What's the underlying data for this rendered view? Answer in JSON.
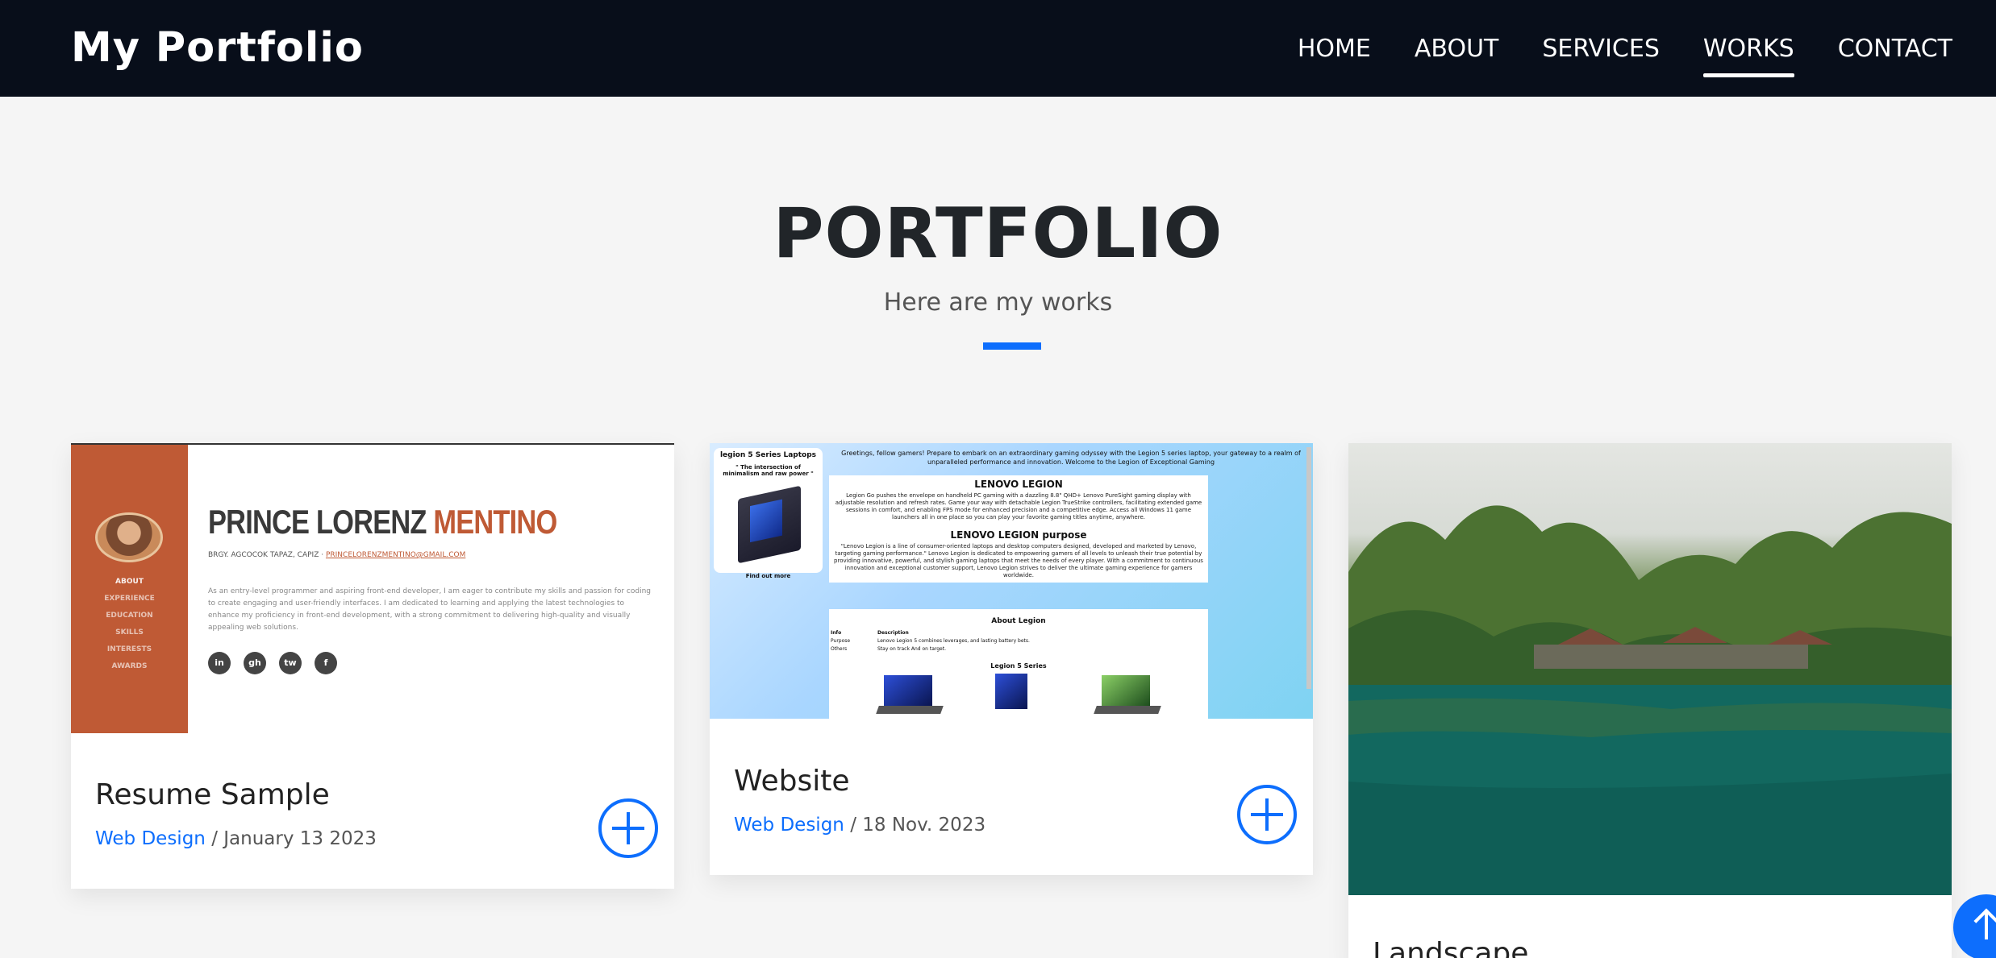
{
  "navbar": {
    "brand": "My Portfolio",
    "links": [
      "HOME",
      "ABOUT",
      "SERVICES",
      "WORKS",
      "CONTACT"
    ],
    "active": "WORKS"
  },
  "section": {
    "title": "PORTFOLIO",
    "subtitle": "Here are my works"
  },
  "works": [
    {
      "title": "Resume Sample",
      "category": "Web Design",
      "separator": "/",
      "date": "January 13 2023",
      "thumbnail": {
        "name_first": "PRINCE LORENZ ",
        "name_last": "MENTINO",
        "contact": "BRGY. AGCOCOK TAPAZ, CAPIZ",
        "email": "PRINCELORENZMENTINO@GMAIL.COM",
        "menu": [
          "ABOUT",
          "EXPERIENCE",
          "EDUCATION",
          "SKILLS",
          "INTERESTS",
          "AWARDS"
        ],
        "description": "As an entry-level programmer and aspiring front-end developer, I am eager to contribute my skills and passion for coding to create engaging and user-friendly interfaces. I am dedicated to learning and applying the latest technologies to enhance my proficiency in front-end development, with a strong commitment to delivering high-quality and visually appealing web solutions.",
        "socials": [
          "in",
          "gh",
          "tw",
          "f"
        ]
      }
    },
    {
      "title": "Website",
      "category": "Web Design",
      "separator": "/",
      "date": "18 Nov. 2023",
      "thumbnail": {
        "sidebar_title": "legion 5 Series Laptops",
        "sidebar_quote": "\" The intersection of minimalism and raw power \"",
        "sidebar_link": "Find out more",
        "intro": "Greetings, fellow gamers! Prepare to embark on an extraordinary gaming odyssey with the Legion 5 series laptop, your gateway to a realm of unparalleled performance and innovation. Welcome to the Legion of Exceptional Gaming",
        "box1_title": "LENOVO LEGION",
        "box1_text": "Legion Go pushes the envelope on handheld PC gaming with a dazzling 8.8\" QHD+ Lenovo PureSight gaming display with adjustable resolution and refresh rates. Game your way with detachable Legion TrueStrike controllers, facilitating extended game sessions in comfort, and enabling FPS mode for enhanced precision and a competitive edge. Access all Windows 11 game launchers all in one place so you can play your favorite gaming titles anytime, anywhere.",
        "box2_title": "LENOVO LEGION purpose",
        "box2_text": "\"Lenovo Legion is a line of consumer-oriented laptops and desktop computers designed, developed and marketed by Lenovo, targeting gaming performance.\" Lenovo Legion is dedicated to empowering gamers of all levels to unleash their true potential by providing innovative, powerful, and stylish gaming laptops that meet the needs of every player. With a commitment to continuous innovation and exceptional customer support, Lenovo Legion strives to deliver the ultimate gaming experience for gamers worldwide.",
        "about_title": "About Legion",
        "table_headers": [
          "Info",
          "Description"
        ],
        "table_rows": [
          [
            "Purpose",
            "Lenovo Legion 5 combines leverages, and lasting battery bets."
          ],
          [
            "Others",
            "Stay on track And on target."
          ]
        ],
        "series_title": "Legion 5 Series"
      }
    },
    {
      "title": "Landscape"
    }
  ]
}
